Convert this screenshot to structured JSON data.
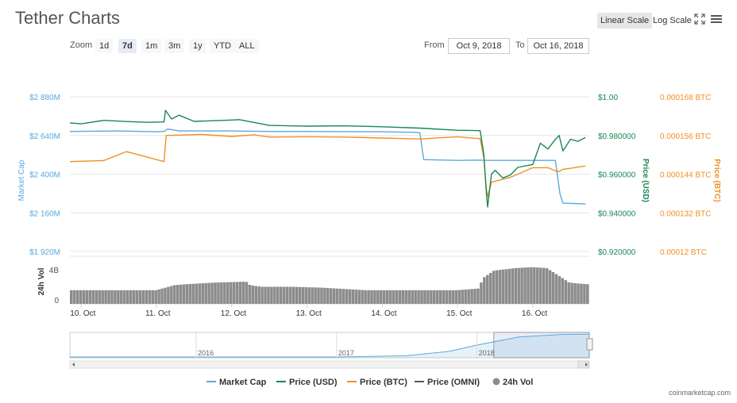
{
  "title": "Tether Charts",
  "toolbar": {
    "linear_scale": "Linear Scale",
    "log_scale": "Log Scale",
    "fullscreen_icon": "expand-icon",
    "menu_icon": "hamburger-menu-icon"
  },
  "zoom": {
    "label": "Zoom",
    "buttons": [
      "1d",
      "7d",
      "1m",
      "3m",
      "1y",
      "YTD",
      "ALL"
    ],
    "active": "7d"
  },
  "range": {
    "from_label": "From",
    "from_value": "Oct 9, 2018",
    "to_label": "To",
    "to_value": "Oct 16, 2018"
  },
  "credit": "coinmarketcap.com",
  "colors": {
    "market_cap": "#5aa9dd",
    "price_usd": "#1a8754",
    "price_btc": "#f0901f",
    "price_omni": "#555555",
    "volume": "#8c8c8c",
    "grid": "#e6e6e6"
  },
  "chart_data": {
    "type": "line",
    "title": "",
    "x_ticks": [
      "10. Oct",
      "11. Oct",
      "12. Oct",
      "13. Oct",
      "14. Oct",
      "15. Oct",
      "16. Oct"
    ],
    "x_range": [
      9.85,
      16.75
    ],
    "left_axis": {
      "label": "Market Cap",
      "ticks": [
        "$2 880M",
        "$2 640M",
        "$2 400M",
        "$2 160M",
        "$1 920M"
      ],
      "range": [
        1920,
        2880
      ]
    },
    "right_axis_usd": {
      "label": "Price (USD)",
      "ticks": [
        "$1.00",
        "$0.980000",
        "$0.960000",
        "$0.940000",
        "$0.920000"
      ],
      "range": [
        0.92,
        1.0
      ]
    },
    "right_axis_btc": {
      "label": "Price (BTC)",
      "ticks": [
        "0.000168 BTC",
        "0.000156 BTC",
        "0.000144 BTC",
        "0.000132 BTC",
        "0.00012 BTC"
      ],
      "range": [
        0.00012,
        0.000168
      ]
    },
    "volume_axis": {
      "label": "24h Vol",
      "ticks": [
        "4B",
        "0"
      ],
      "range": [
        0,
        4
      ]
    },
    "series": [
      {
        "name": "Market Cap",
        "axis": "left",
        "x": [
          9.85,
          10.5,
          11.0,
          11.1,
          11.15,
          11.3,
          12.0,
          12.5,
          13.0,
          13.5,
          14.0,
          14.4,
          14.5,
          14.55,
          15.0,
          15.3,
          15.4,
          15.8,
          16.0,
          16.3,
          16.36,
          16.4,
          16.7
        ],
        "y": [
          2665,
          2668,
          2663,
          2665,
          2680,
          2668,
          2668,
          2665,
          2665,
          2664,
          2663,
          2660,
          2657,
          2490,
          2485,
          2487,
          2485,
          2485,
          2485,
          2485,
          2280,
          2220,
          2215
        ]
      },
      {
        "name": "Price (USD)",
        "axis": "usd",
        "x": [
          9.85,
          10.0,
          10.3,
          10.6,
          10.9,
          11.1,
          11.12,
          11.2,
          11.3,
          11.5,
          12.0,
          12.1,
          12.5,
          13.0,
          13.5,
          14.0,
          14.5,
          15.0,
          15.3,
          15.35,
          15.38,
          15.4,
          15.45,
          15.5,
          15.6,
          15.7,
          15.8,
          16.0,
          16.1,
          16.2,
          16.3,
          16.35,
          16.4,
          16.5,
          16.6,
          16.7
        ],
        "y": [
          0.9865,
          0.986,
          0.9878,
          0.9872,
          0.9868,
          0.987,
          0.993,
          0.9885,
          0.9905,
          0.9873,
          0.988,
          0.9882,
          0.9852,
          0.9848,
          0.985,
          0.9845,
          0.9838,
          0.9827,
          0.9825,
          0.97,
          0.952,
          0.943,
          0.96,
          0.962,
          0.958,
          0.9595,
          0.9635,
          0.965,
          0.976,
          0.973,
          0.978,
          0.98,
          0.972,
          0.978,
          0.977,
          0.979
        ]
      },
      {
        "name": "Price (BTC)",
        "axis": "btc",
        "x": [
          9.85,
          10.3,
          10.6,
          11.1,
          11.13,
          11.3,
          11.6,
          12.0,
          12.3,
          12.5,
          13.0,
          13.5,
          14.0,
          14.5,
          15.0,
          15.3,
          15.35,
          15.38,
          15.4,
          15.45,
          15.5,
          15.7,
          15.8,
          16.0,
          16.2,
          16.3,
          16.35,
          16.4,
          16.5,
          16.6,
          16.7
        ],
        "y": [
          0.0001479,
          0.0001482,
          0.000151,
          0.0001479,
          0.000156,
          0.0001561,
          0.0001563,
          0.0001557,
          0.0001562,
          0.0001555,
          0.0001556,
          0.0001555,
          0.0001552,
          0.0001549,
          0.0001556,
          0.000155,
          0.000149,
          0.00014,
          0.000137,
          0.0001415,
          0.0001418,
          0.000143,
          0.000144,
          0.000146,
          0.000146,
          0.000145,
          0.0001448,
          0.0001455,
          0.0001458,
          0.0001462,
          0.0001465
        ]
      },
      {
        "name": "Price (OMNI)",
        "axis": "usd",
        "x": [],
        "y": []
      },
      {
        "name": "24h Vol",
        "axis": "volume",
        "x": [
          9.85,
          10.5,
          11.0,
          11.25,
          11.4,
          11.8,
          12.2,
          12.25,
          12.4,
          12.8,
          13.2,
          13.8,
          14.2,
          14.6,
          15.0,
          15.3,
          15.35,
          15.5,
          15.8,
          16.0,
          16.2,
          16.4,
          16.5,
          16.6,
          16.75
        ],
        "y": [
          1.6,
          1.6,
          1.6,
          2.2,
          2.3,
          2.5,
          2.6,
          2.2,
          2.0,
          2.0,
          1.9,
          1.6,
          1.6,
          1.6,
          1.6,
          1.8,
          3.0,
          3.9,
          4.2,
          4.3,
          4.2,
          3.1,
          2.5,
          2.4,
          2.3
        ]
      }
    ],
    "legend": {
      "placement": "bottom",
      "items": [
        "Market Cap",
        "Price (USD)",
        "Price (BTC)",
        "Price (OMNI)",
        "24h Vol"
      ]
    },
    "navigator": {
      "years": [
        "2016",
        "2017",
        "2018"
      ],
      "x_range": [
        2015.1,
        2018.8
      ],
      "selected": [
        2018.12,
        2018.8
      ],
      "x": [
        2015.1,
        2016.5,
        2017.0,
        2017.5,
        2017.8,
        2018.0,
        2018.3,
        2018.6,
        2018.8
      ],
      "y": [
        0.03,
        0.03,
        0.03,
        0.08,
        0.25,
        0.5,
        0.82,
        0.92,
        0.93
      ]
    },
    "grid": true
  }
}
